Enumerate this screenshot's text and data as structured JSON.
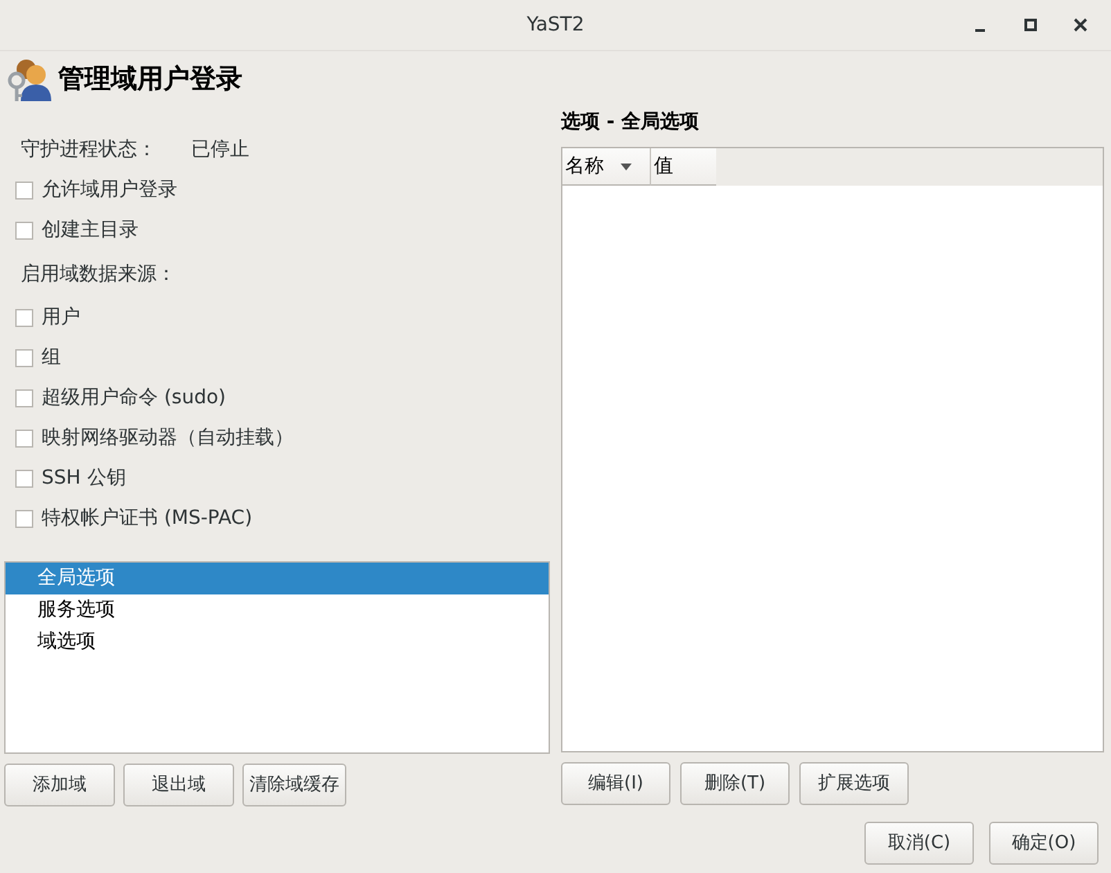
{
  "window": {
    "title": "YaST2"
  },
  "header": {
    "title": "管理域用户登录"
  },
  "left_items": [
    {
      "kind": "status",
      "label": "守护进程状态：",
      "value": "已停止"
    },
    {
      "kind": "checkbox",
      "label": "允许域用户登录",
      "checked": false
    },
    {
      "kind": "checkbox",
      "label": "创建主目录",
      "checked": false
    },
    {
      "kind": "heading",
      "label": "启用域数据来源："
    },
    {
      "kind": "checkbox",
      "label": "用户",
      "checked": false
    },
    {
      "kind": "checkbox",
      "label": "组",
      "checked": false
    },
    {
      "kind": "checkbox",
      "label": "超级用户命令 (sudo)",
      "checked": false
    },
    {
      "kind": "checkbox",
      "label": "映射网络驱动器（自动挂载）",
      "checked": false
    },
    {
      "kind": "checkbox",
      "label": "SSH 公钥",
      "checked": false
    },
    {
      "kind": "checkbox",
      "label": "特权帐户证书 (MS-PAC)",
      "checked": false
    }
  ],
  "sections": [
    {
      "label": "全局选项",
      "selected": true
    },
    {
      "label": "服务选项",
      "selected": false
    },
    {
      "label": "域选项",
      "selected": false
    }
  ],
  "left_buttons": [
    "添加域",
    "退出域",
    "清除域缓存"
  ],
  "options": {
    "title": "选项 - 全局选项",
    "columns": [
      {
        "label": "名称",
        "sorted": true
      },
      {
        "label": "值",
        "sorted": false
      }
    ]
  },
  "right_buttons": [
    "编辑(I)",
    "删除(T)",
    "扩展选项"
  ],
  "dialog_buttons": [
    "取消(C)",
    "确定(O)"
  ]
}
